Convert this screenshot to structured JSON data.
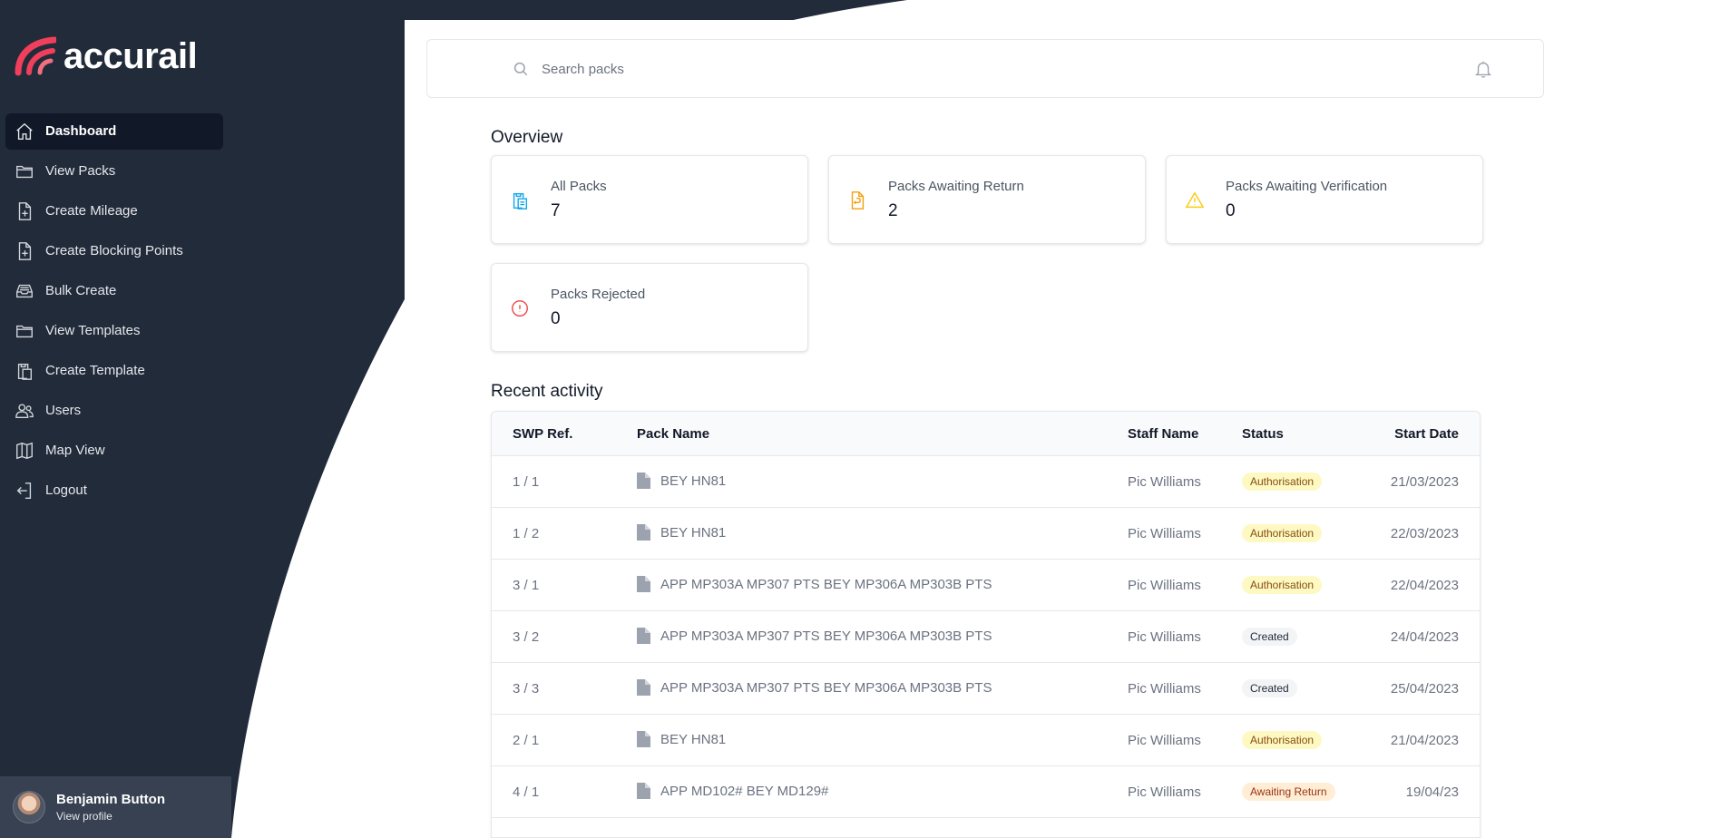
{
  "brand": {
    "name": "accurail",
    "accent": "#ef3f5a"
  },
  "nav": {
    "items": [
      {
        "label": "Dashboard",
        "icon": "home-icon",
        "active": true
      },
      {
        "label": "View Packs",
        "icon": "folder-icon"
      },
      {
        "label": "Create Mileage",
        "icon": "document-plus-icon"
      },
      {
        "label": "Create Blocking Points",
        "icon": "document-plus-icon"
      },
      {
        "label": "Bulk Create",
        "icon": "inbox-stack-icon"
      },
      {
        "label": "View Templates",
        "icon": "folder-icon"
      },
      {
        "label": "Create Template",
        "icon": "clipboard-copy-icon"
      },
      {
        "label": "Users",
        "icon": "users-icon"
      },
      {
        "label": "Map View",
        "icon": "map-icon"
      },
      {
        "label": "Logout",
        "icon": "logout-icon"
      }
    ]
  },
  "profile": {
    "name": "Benjamin Button",
    "link": "View profile"
  },
  "search": {
    "placeholder": "Search packs"
  },
  "overview": {
    "title": "Overview",
    "cards": [
      {
        "label": "All Packs",
        "value": "7",
        "icon": "clipboard-document-icon",
        "color": "#0ea5e9"
      },
      {
        "label": "Packs Awaiting Return",
        "value": "2",
        "icon": "document-return-icon",
        "color": "#f59e0b"
      },
      {
        "label": "Packs Awaiting Verification",
        "value": "0",
        "icon": "warning-triangle-icon",
        "color": "#facc15"
      },
      {
        "label": "Packs Rejected",
        "value": "0",
        "icon": "exclamation-circle-icon",
        "color": "#ef4444"
      }
    ]
  },
  "activity": {
    "title": "Recent activity",
    "columns": [
      "SWP Ref.",
      "Pack Name",
      "Staff Name",
      "Status",
      "Start Date"
    ],
    "rows": [
      {
        "ref": "1 / 1",
        "pack": "BEY HN81",
        "staff": "Pic Williams",
        "status": "Authorisation",
        "kind": "auth",
        "date": "21/03/2023"
      },
      {
        "ref": "1 / 2",
        "pack": "BEY HN81",
        "staff": "Pic Williams",
        "status": "Authorisation",
        "kind": "auth",
        "date": "22/03/2023"
      },
      {
        "ref": "3 / 1",
        "pack": "APP MP303A MP307 PTS BEY MP306A MP303B PTS",
        "staff": "Pic Williams",
        "status": "Authorisation",
        "kind": "auth",
        "date": "22/04/2023"
      },
      {
        "ref": "3 / 2",
        "pack": "APP MP303A MP307 PTS BEY MP306A MP303B PTS",
        "staff": "Pic Williams",
        "status": "Created",
        "kind": "created",
        "date": "24/04/2023"
      },
      {
        "ref": "3 / 3",
        "pack": "APP MP303A MP307 PTS BEY MP306A MP303B PTS",
        "staff": "Pic Williams",
        "status": "Created",
        "kind": "created",
        "date": "25/04/2023"
      },
      {
        "ref": "2 / 1",
        "pack": "BEY HN81",
        "staff": "Pic Williams",
        "status": "Authorisation",
        "kind": "auth",
        "date": "21/04/2023"
      },
      {
        "ref": "4 / 1",
        "pack": "APP MD102# BEY MD129#",
        "staff": "Pic Williams",
        "status": "Awaiting Return",
        "kind": "awaiting",
        "date": "19/04/23"
      }
    ]
  }
}
